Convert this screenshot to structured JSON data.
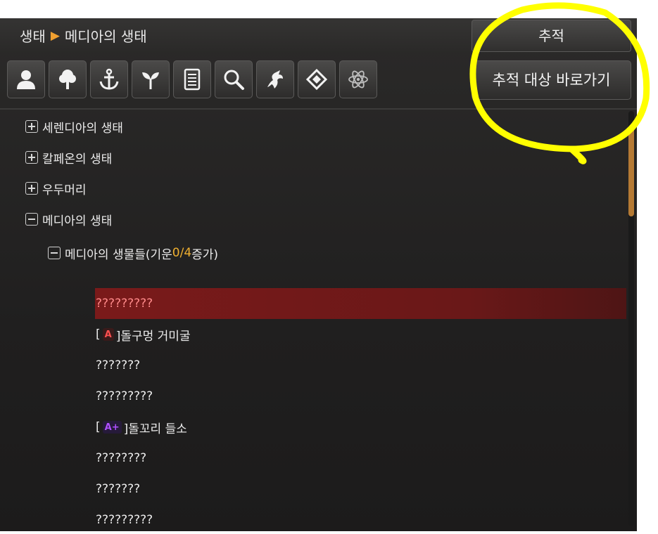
{
  "header": {
    "breadcrumb": [
      "생태",
      "메디아의 생태"
    ],
    "track_button": "추적"
  },
  "toolbar": {
    "icons": [
      "person-icon",
      "tree-icon",
      "anchor-icon",
      "sprout-icon",
      "book-icon",
      "magnifier-icon",
      "dragon-icon",
      "diamond-icon",
      "atom-icon"
    ],
    "goto_button": "추적 대상 바로가기"
  },
  "tree": {
    "sections": [
      {
        "label": "세렌디아의 생태",
        "expanded": false
      },
      {
        "label": "칼페온의 생태",
        "expanded": false
      },
      {
        "label": "우두머리",
        "expanded": false
      },
      {
        "label": "메디아의 생태",
        "expanded": true
      }
    ],
    "subsection": {
      "label_prefix": "메디아의 생물들(기운 ",
      "progress": "0/4",
      "label_suffix": " 증가)"
    },
    "items": [
      {
        "text": "?????????"
      },
      {
        "open": "[",
        "grade": "A",
        "close": "]돌구멍 거미굴"
      },
      {
        "text": "???????"
      },
      {
        "text": "?????????"
      },
      {
        "open": "[",
        "grade": "A+",
        "close": "]돌꼬리 들소"
      },
      {
        "text": "????????"
      },
      {
        "text": "???????"
      },
      {
        "text": "?????????"
      }
    ]
  },
  "colors": {
    "accent": "#f0b030",
    "highlight": "#7a1a1a",
    "annotation": "#ffff00",
    "grade_a": "#ff5050",
    "grade_a_plus": "#b050ff"
  }
}
